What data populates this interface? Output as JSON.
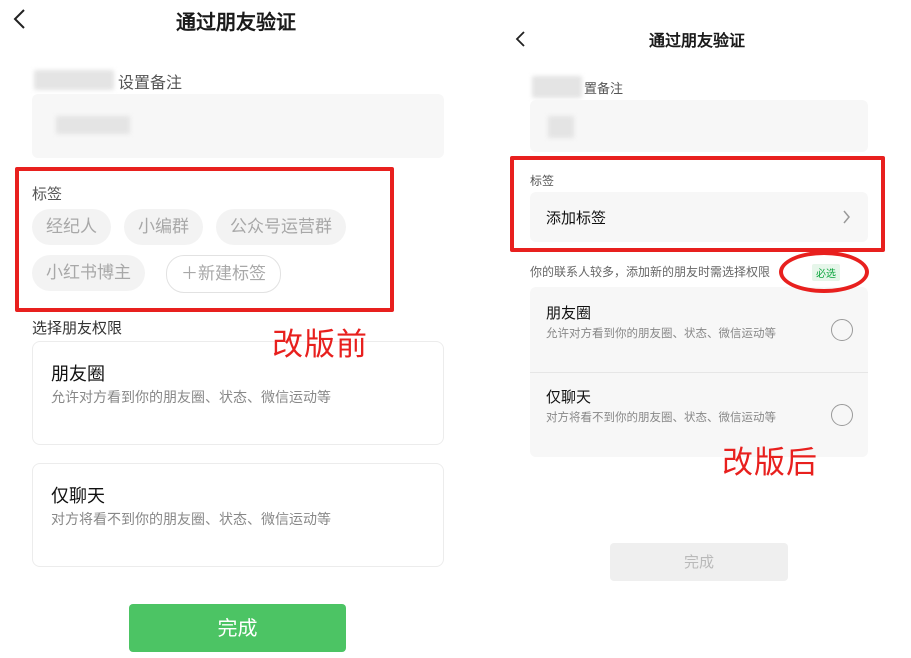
{
  "before": {
    "header": {
      "back_icon": "chevron-left-icon",
      "title": "通过朋友验证"
    },
    "remark": {
      "label_suffix": "设置备注"
    },
    "tags": {
      "label": "标签",
      "chips": [
        "经纪人",
        "小编群",
        "公众号运营群",
        "小红书博主"
      ],
      "new_chip": "＋新建标签"
    },
    "permission": {
      "label": "选择朋友权限",
      "options": [
        {
          "title": "朋友圈",
          "desc": "允许对方看到你的朋友圈、状态、微信运动等"
        },
        {
          "title": "仅聊天",
          "desc": "对方将看不到你的朋友圈、状态、微信运动等"
        }
      ]
    },
    "done_label": "完成",
    "annotation": "改版前"
  },
  "after": {
    "header": {
      "back_icon": "chevron-left-icon",
      "title": "通过朋友验证"
    },
    "remark": {
      "label_suffix": "置备注"
    },
    "tags": {
      "label": "标签",
      "add_label": "添加标签",
      "chevron_icon": "chevron-right-icon"
    },
    "hint": {
      "text": "你的联系人较多，添加新的朋友时需选择权限",
      "required_badge": "必选"
    },
    "permission": {
      "options": [
        {
          "title": "朋友圈",
          "desc": "允许对方看到你的朋友圈、状态、微信运动等"
        },
        {
          "title": "仅聊天",
          "desc": "对方将看不到你的朋友圈、状态、微信运动等"
        }
      ]
    },
    "done_label": "完成",
    "annotation": "改版后"
  },
  "colors": {
    "accent_green": "#4cc464",
    "annotation_red": "#e8201e"
  }
}
